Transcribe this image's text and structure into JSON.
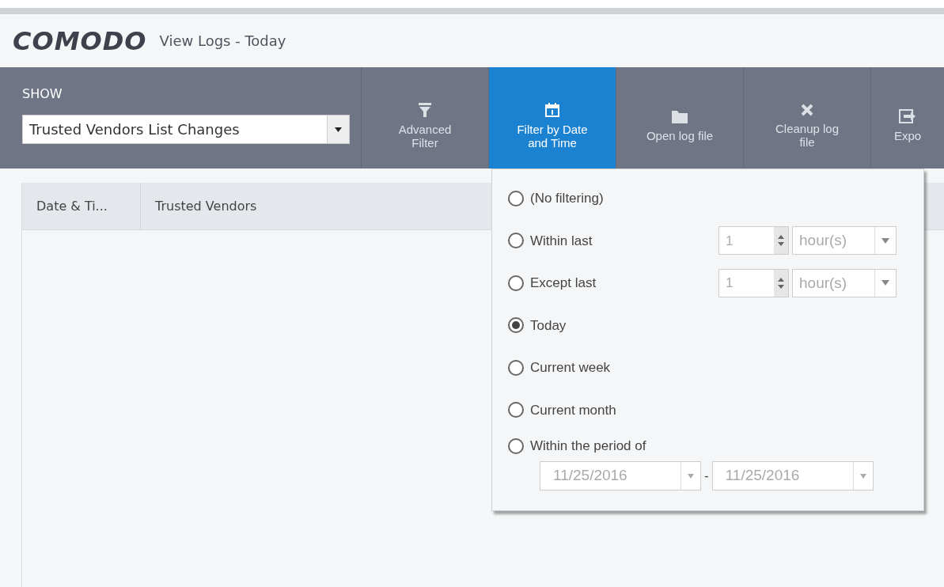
{
  "header": {
    "logo": "COMODO",
    "title": "View Logs - Today"
  },
  "show": {
    "label": "SHOW",
    "value": "Trusted Vendors List Changes"
  },
  "toolbar": [
    {
      "label": "Advanced Filter",
      "selected": false
    },
    {
      "label": "Filter by Date and Time",
      "selected": true
    },
    {
      "label": "Open log file",
      "selected": false
    },
    {
      "label": "Cleanup log file",
      "selected": false
    },
    {
      "label": "Expo",
      "selected": false
    }
  ],
  "table": {
    "columns": [
      "Date & Ti...",
      "Trusted Vendors"
    ]
  },
  "date_filter": {
    "options": [
      {
        "kind": "plain",
        "label": "(No filtering)",
        "selected": false
      },
      {
        "kind": "count",
        "label": "Within last",
        "selected": false,
        "count": "1",
        "unit": "hour(s)"
      },
      {
        "kind": "count",
        "label": "Except last",
        "selected": false,
        "count": "1",
        "unit": "hour(s)"
      },
      {
        "kind": "plain",
        "label": "Today",
        "selected": true
      },
      {
        "kind": "plain",
        "label": "Current week",
        "selected": false
      },
      {
        "kind": "plain",
        "label": "Current month",
        "selected": false
      },
      {
        "kind": "period",
        "label": "Within the period of",
        "selected": false,
        "from": "11/25/2016",
        "separator": "-",
        "to": "11/25/2016"
      }
    ]
  }
}
